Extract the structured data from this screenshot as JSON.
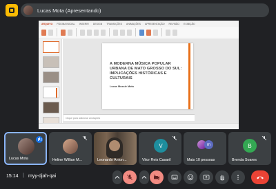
{
  "presenter_bar": {
    "label": "Lucas Mota (Apresentando)"
  },
  "presentation": {
    "ribbon_tabs": [
      "ARQUIVO",
      "PÁGINA INICIAL",
      "INSERIR",
      "DESIGN",
      "TRANSIÇÕES",
      "ANIMAÇÕES",
      "APRESENTAÇÃO",
      "REVISÃO",
      "EXIBIÇÃO"
    ],
    "slide_title": "A MODERNA MÚSICA POPULAR URBANA DE MATO GROSSO DO SUL: IMPLICAÇÕES HISTÓRICAS E CULTURAIS",
    "slide_author": "Lucas Mussie Mota",
    "notes_placeholder": "Clique para adicionar anotações",
    "accent_color": "#e8701a"
  },
  "participants": [
    {
      "name": "Lucas Mota",
      "state": "speaking",
      "avatar": "photo"
    },
    {
      "name": "Heline Willian M...",
      "state": "muted",
      "avatar": "photo"
    },
    {
      "name": "Leonardo Anton...",
      "state": "video",
      "avatar": "video"
    },
    {
      "name": "Vitor Reis Casaril",
      "state": "muted",
      "avatar": "initial",
      "initial": "V",
      "color": "#1e8e9e"
    },
    {
      "name": "Mais 10 pessoas",
      "state": "group",
      "avatar": "group",
      "initial": "m"
    },
    {
      "name": "Brenda Soares",
      "state": "muted",
      "avatar": "initial",
      "initial": "B",
      "color": "#34a853"
    }
  ],
  "meeting": {
    "time": "15:14",
    "code": "myy-djah-qai"
  },
  "controls": {
    "icons": [
      "chevron-up-icon",
      "mic-off-icon",
      "chevron-up-icon",
      "camera-off-icon",
      "closed-captions-icon",
      "emoji-icon",
      "present-icon",
      "raise-hand-icon",
      "more-options-icon",
      "leave-call-icon"
    ],
    "right_icons": [
      "info-icon",
      "people-icon",
      "chat-icon",
      "activities-icon"
    ]
  }
}
